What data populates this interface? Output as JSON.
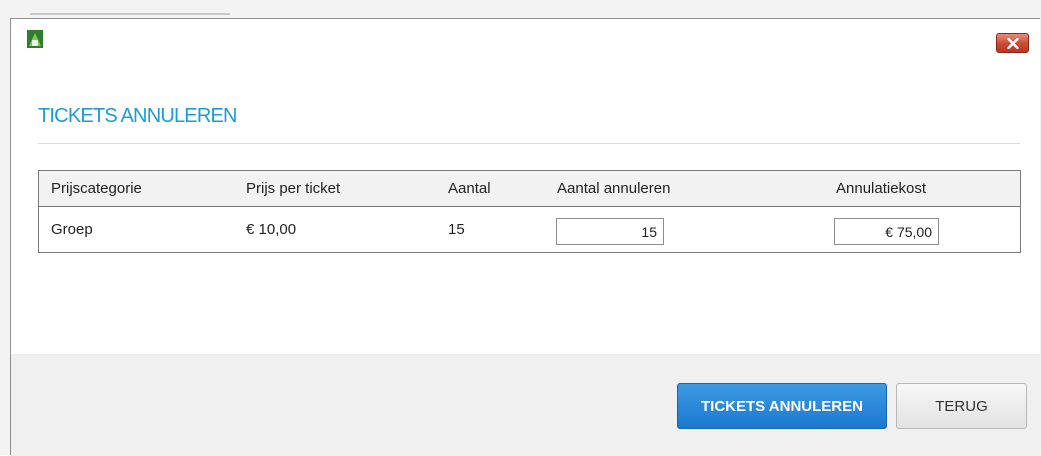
{
  "dialog": {
    "heading": "TICKETS ANNULEREN"
  },
  "table": {
    "columns": [
      "Prijscategorie",
      "Prijs per ticket",
      "Aantal",
      "Aantal annuleren",
      "Annulatiekost"
    ],
    "rows": [
      {
        "category": "Groep",
        "price": "€ 10,00",
        "quantity": "15",
        "cancel_quantity": "15",
        "cancel_cost": "€ 75,00"
      }
    ]
  },
  "footer": {
    "confirm_label": "TICKETS ANNULEREN",
    "back_label": "TERUG"
  },
  "icons": {
    "app": "app-icon",
    "close": "close-icon"
  },
  "colors": {
    "accent": "#1f9ad6",
    "primary_button": "#1c78cf",
    "close_button": "#c94a33"
  }
}
